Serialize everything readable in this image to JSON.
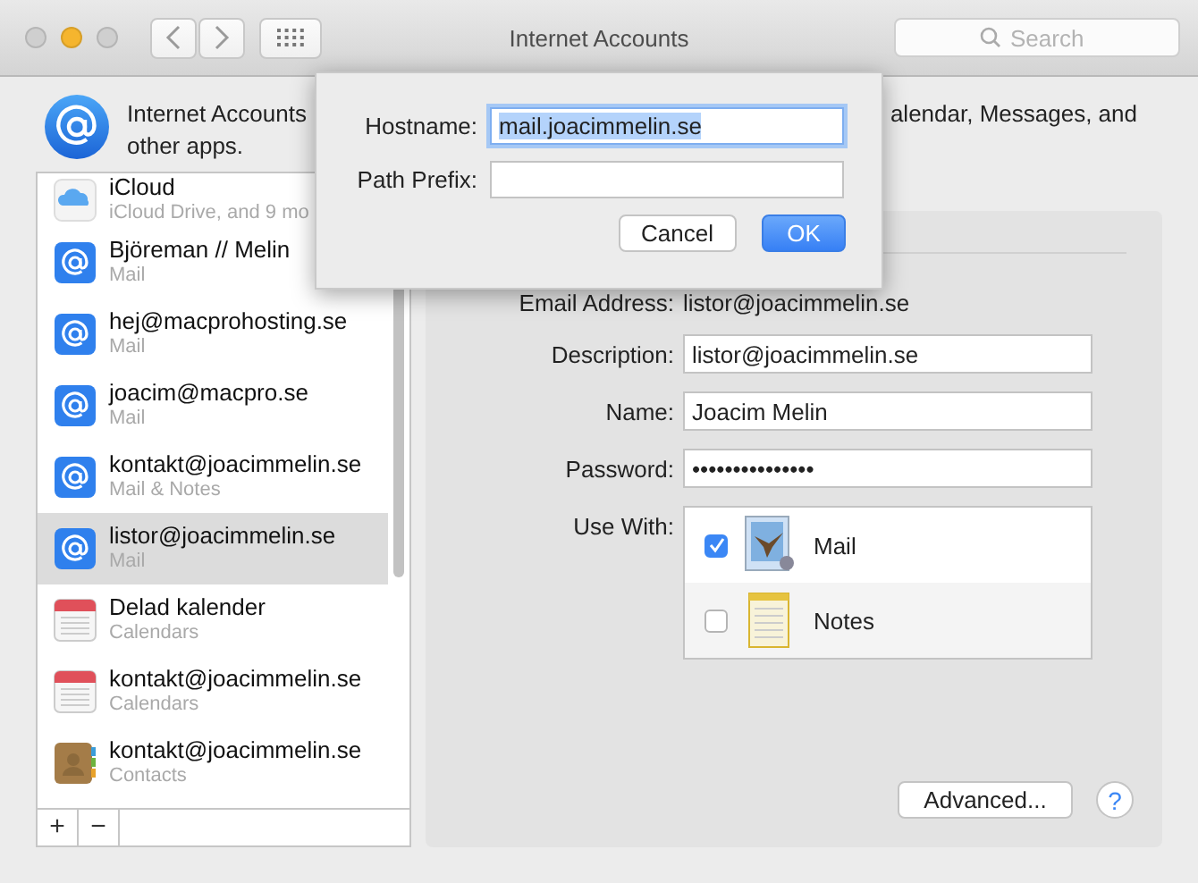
{
  "window": {
    "title": "Internet Accounts",
    "traffic_lights": [
      {
        "color": "#cfcfcf"
      },
      {
        "color": "#f5b52e"
      },
      {
        "color": "#cfcfcf"
      }
    ]
  },
  "toolbar": {
    "search": {
      "placeholder": "Search"
    }
  },
  "header": {
    "line1_start": "Internet Accounts",
    "line1_end": "alendar, Messages, and",
    "line2": "other apps."
  },
  "accounts": [
    {
      "kind": "icloud",
      "title": "iCloud",
      "subtitle": "iCloud Drive, and 9 mo",
      "selected": false
    },
    {
      "kind": "mail",
      "title": "Björeman // Melin",
      "subtitle": "Mail",
      "selected": false
    },
    {
      "kind": "mail",
      "title": "hej@macprohosting.se",
      "subtitle": "Mail",
      "selected": false
    },
    {
      "kind": "mail",
      "title": "joacim@macpro.se",
      "subtitle": "Mail",
      "selected": false
    },
    {
      "kind": "mail",
      "title": "kontakt@joacimmelin.se",
      "subtitle": "Mail & Notes",
      "selected": false
    },
    {
      "kind": "mail",
      "title": "listor@joacimmelin.se",
      "subtitle": "Mail",
      "selected": true
    },
    {
      "kind": "calendar",
      "title": "Delad kalender",
      "subtitle": "Calendars",
      "selected": false
    },
    {
      "kind": "calendar",
      "title": "kontakt@joacimmelin.se",
      "subtitle": "Calendars",
      "selected": false
    },
    {
      "kind": "contacts",
      "title": "kontakt@joacimmelin.se",
      "subtitle": "Contacts",
      "selected": false
    }
  ],
  "list_buttons": [
    "+",
    "−"
  ],
  "details": {
    "email_label": "Email Address:",
    "email_value": "listor@joacimmelin.se",
    "fields": [
      {
        "label": "Description:",
        "value": "listor@joacimmelin.se"
      },
      {
        "label": "Name:",
        "value": "Joacim Melin"
      },
      {
        "label": "Password:",
        "value": "•••••••••••••••"
      }
    ],
    "use_with_label": "Use With:",
    "apps": [
      {
        "kind": "mail",
        "name": "Mail",
        "checked": true
      },
      {
        "kind": "notes",
        "name": "Notes",
        "checked": false
      }
    ],
    "advanced_button": "Advanced...",
    "help_button": "?"
  },
  "sheet": {
    "fields": [
      {
        "label": "Hostname:",
        "value": "mail.joacimmelin.se",
        "selected": true
      },
      {
        "label": "Path Prefix:",
        "selected": false
      }
    ],
    "buttons": [
      {
        "label": "Cancel",
        "default": false
      },
      {
        "label": "OK",
        "default": true
      }
    ]
  }
}
